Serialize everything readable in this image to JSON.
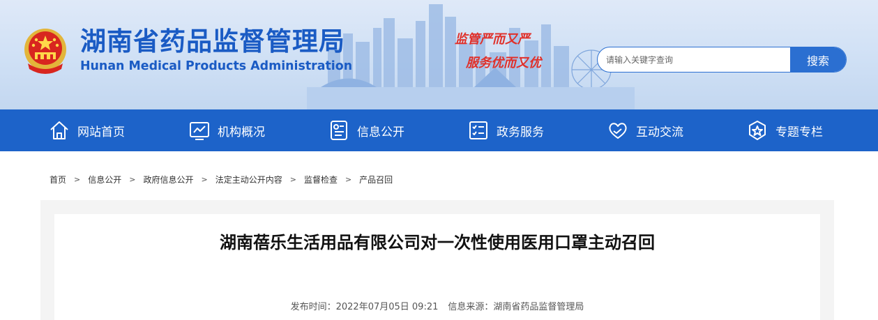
{
  "header": {
    "title": "湖南省药品监督管理局",
    "subtitle": "Hunan Medical Products Administration",
    "slogan_line1": "监管严而又严",
    "slogan_line2": "服务优而又优"
  },
  "search": {
    "placeholder": "请输入关键字查询",
    "button_label": "搜索"
  },
  "nav": {
    "items": [
      {
        "label": "网站首页",
        "icon": "home-icon"
      },
      {
        "label": "机构概况",
        "icon": "chart-icon"
      },
      {
        "label": "信息公开",
        "icon": "document-icon"
      },
      {
        "label": "政务服务",
        "icon": "checklist-icon"
      },
      {
        "label": "互动交流",
        "icon": "heart-hands-icon"
      },
      {
        "label": "专题专栏",
        "icon": "star-badge-icon"
      }
    ]
  },
  "breadcrumb": [
    "首页",
    "信息公开",
    "政府信息公开",
    "法定主动公开内容",
    "监督检查",
    "产品召回"
  ],
  "breadcrumb_separator": ">",
  "article": {
    "title": "湖南蓓乐生活用品有限公司对一次性使用医用口罩主动召回",
    "publish_label": "发布时间：",
    "publish_time": "2022年07月05日 09:21",
    "source_label": "信息来源：",
    "source": "湖南省药品监督管理局"
  },
  "colors": {
    "brand_blue": "#1a5bc4",
    "nav_blue": "#1d63c9",
    "slogan_red": "#e0302a"
  }
}
